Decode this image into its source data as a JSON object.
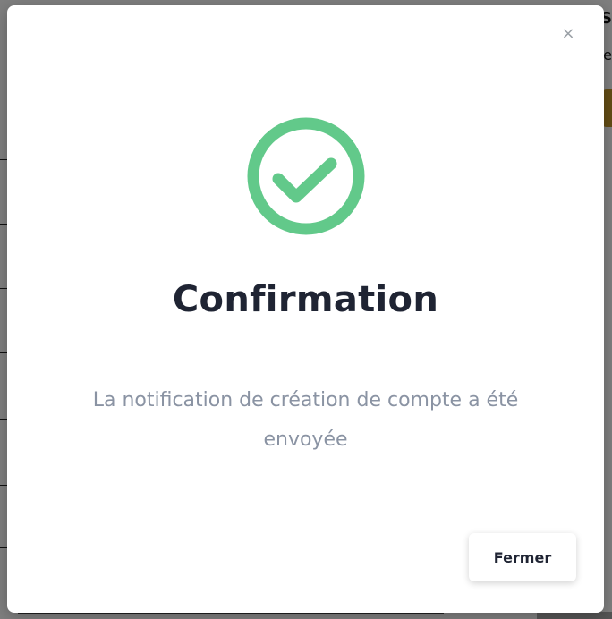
{
  "modal": {
    "title": "Confirmation",
    "message": "La notification de création de compte a été envoyée",
    "close_icon_glyph": "×",
    "close_button_label": "Fermer",
    "status_icon": "check-circle-icon",
    "status_color": "#62c98a"
  },
  "background": {
    "right_text_top": "S",
    "right_text_sub": "e"
  }
}
